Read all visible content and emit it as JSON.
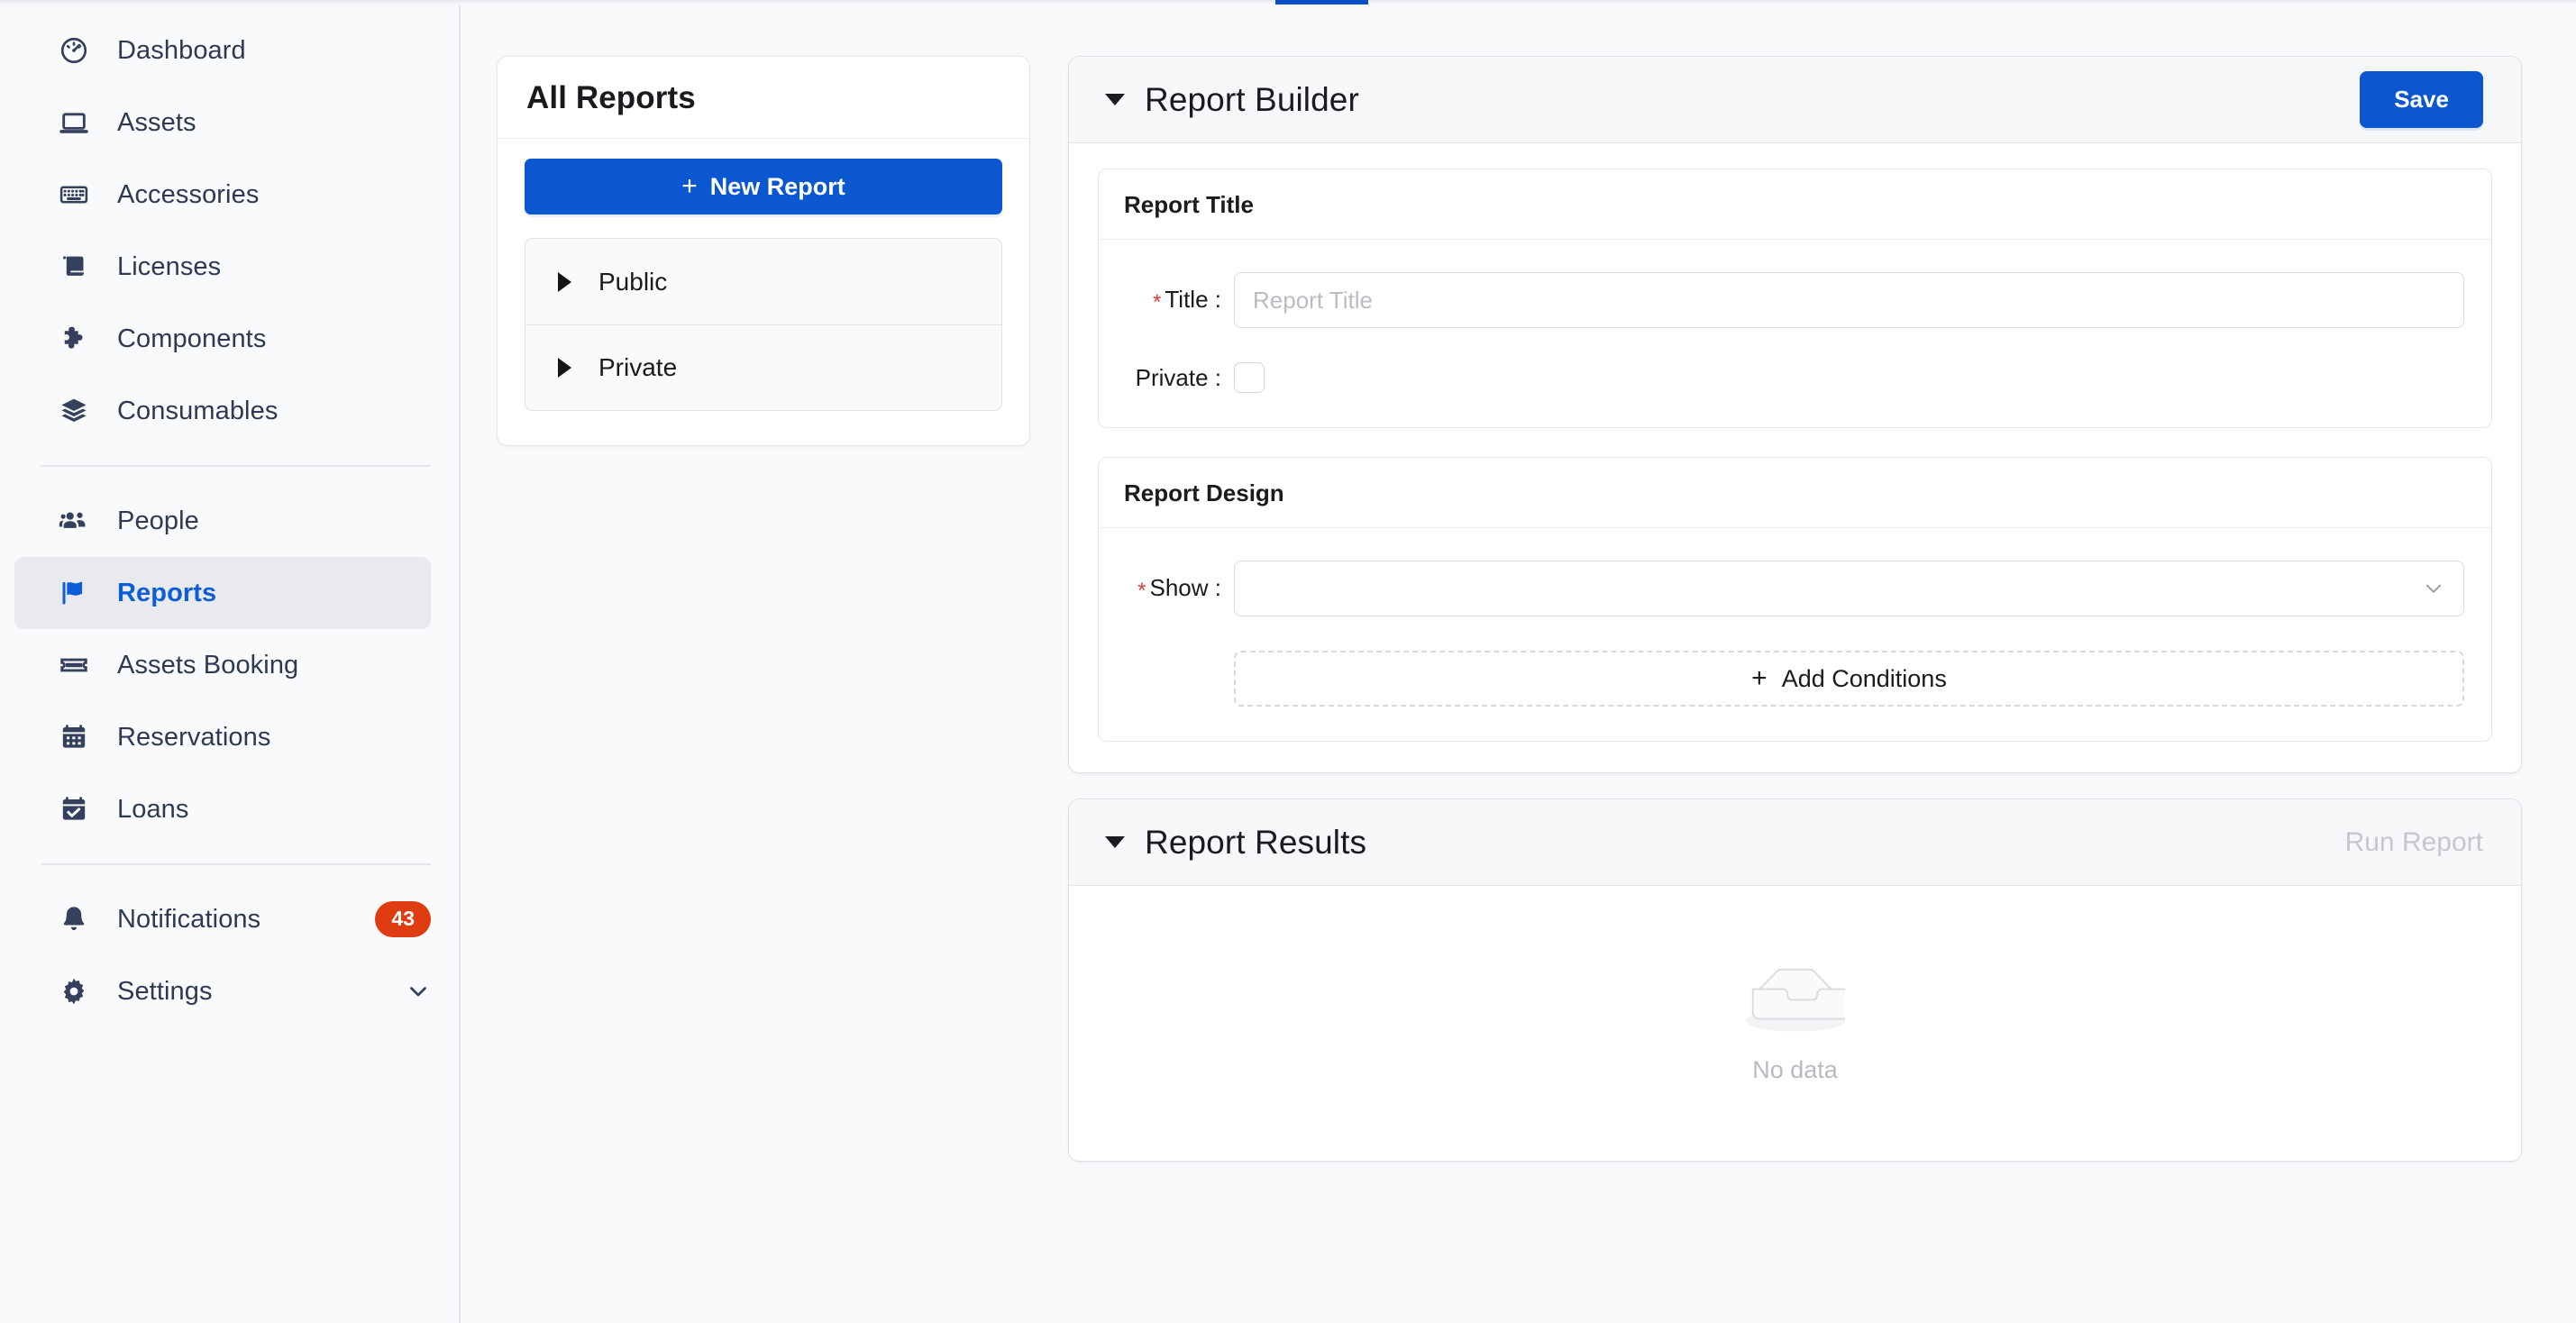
{
  "colors": {
    "accent_blue": "#0b57d0",
    "active_nav_blue": "#0b5ed7",
    "badge_red": "#e03c12",
    "page_bg": "#f8f9fb",
    "sidebar_bg": "#f9fafc",
    "panel_header_bg": "#f6f7f9",
    "required_star": "#e53935",
    "disabled_text": "#c4c7cd",
    "empty_text": "#b7bbc1"
  },
  "sidebar": {
    "groups": [
      {
        "items": [
          {
            "label": "Dashboard",
            "icon": "gauge-icon",
            "active": false
          },
          {
            "label": "Assets",
            "icon": "laptop-icon",
            "active": false
          },
          {
            "label": "Accessories",
            "icon": "keyboard-icon",
            "active": false
          },
          {
            "label": "Licenses",
            "icon": "scroll-icon",
            "active": false
          },
          {
            "label": "Components",
            "icon": "puzzle-piece-icon",
            "active": false
          },
          {
            "label": "Consumables",
            "icon": "layers-icon",
            "active": false
          }
        ]
      },
      {
        "items": [
          {
            "label": "People",
            "icon": "people-icon",
            "active": false
          },
          {
            "label": "Reports",
            "icon": "flag-icon",
            "active": true
          },
          {
            "label": "Assets Booking",
            "icon": "ticket-icon",
            "active": false
          },
          {
            "label": "Reservations",
            "icon": "calendar-icon",
            "active": false
          },
          {
            "label": "Loans",
            "icon": "calendar-check-icon",
            "active": false
          }
        ]
      },
      {
        "items": [
          {
            "label": "Notifications",
            "icon": "bell-icon",
            "active": false,
            "badge": "43"
          },
          {
            "label": "Settings",
            "icon": "gear-icon",
            "active": false,
            "chevron": "chevron-down-icon"
          }
        ]
      }
    ]
  },
  "all_reports": {
    "title": "All Reports",
    "new_report_button": "New Report",
    "new_report_plus": "+",
    "tree": [
      {
        "label": "Public",
        "expanded": false
      },
      {
        "label": "Private",
        "expanded": false
      }
    ]
  },
  "report_builder": {
    "title": "Report Builder",
    "save_label": "Save",
    "report_title_card": {
      "header": "Report Title",
      "title_label": "Title :",
      "title_value": "",
      "title_placeholder": "Report Title",
      "private_label": "Private :",
      "private_checked": false
    },
    "report_design_card": {
      "header": "Report Design",
      "show_label": "Show :",
      "show_value": "",
      "add_conditions_label": "Add Conditions",
      "add_conditions_plus": "+"
    }
  },
  "report_results": {
    "title": "Report Results",
    "run_report_label": "Run Report",
    "empty_text": "No data"
  }
}
